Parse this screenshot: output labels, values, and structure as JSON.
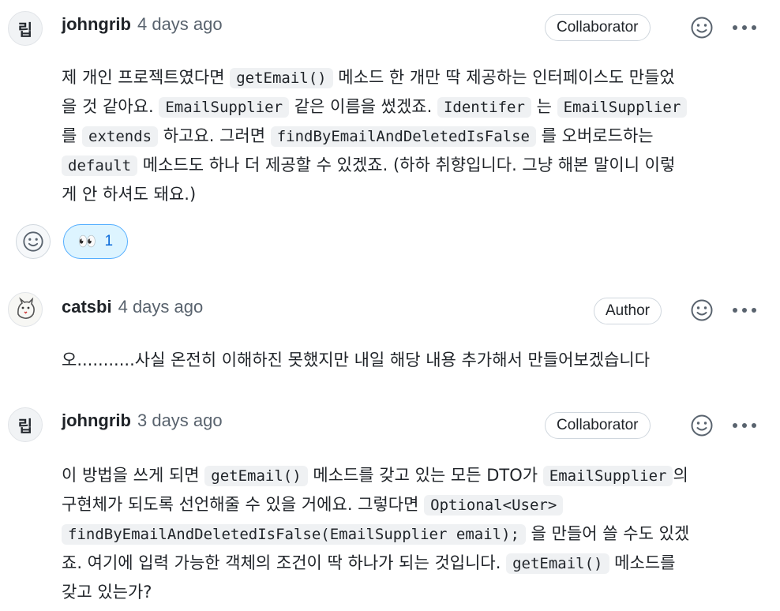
{
  "comments": [
    {
      "avatar_text": "립",
      "author": "johngrib",
      "time": "4 days ago",
      "badge": "Collaborator",
      "lines": [
        [
          {
            "t": "제 개인 프로젝트였다면 "
          },
          {
            "c": "getEmail()"
          },
          {
            "t": " 메소드 한 개만 딱 제공하는 인터페이스도 만들었"
          }
        ],
        [
          {
            "t": "을 것 같아요. "
          },
          {
            "c": "EmailSupplier"
          },
          {
            "t": " 같은 이름을 썼겠죠. "
          },
          {
            "c": "Identifer"
          },
          {
            "t": " 는 "
          },
          {
            "c": "EmailSupplier"
          }
        ],
        [
          {
            "t": "를 "
          },
          {
            "c": "extends"
          },
          {
            "t": " 하고요. 그러면 "
          },
          {
            "c": "findByEmailAndDeletedIsFalse"
          },
          {
            "t": " 를 오버로드하는"
          }
        ],
        [
          {
            "c": "default"
          },
          {
            "t": " 메소드도 하나 더 제공할 수 있겠죠. (하하 취향입니다. 그냥 해본 말이니 이렇"
          }
        ],
        [
          {
            "t": "게 안 하셔도 돼요.)"
          }
        ]
      ],
      "reaction": {
        "emoji": "👀",
        "count": "1"
      }
    },
    {
      "author": "catsbi",
      "time": "4 days ago",
      "badge": "Author",
      "text": "오...........사실 온전히 이해하진 못했지만 내일 해당 내용 추가해서 만들어보겠습니다"
    },
    {
      "avatar_text": "립",
      "author": "johngrib",
      "time": "3 days ago",
      "badge": "Collaborator",
      "lines": [
        [
          {
            "t": "이 방법을 쓰게 되면 "
          },
          {
            "c": "getEmail()"
          },
          {
            "t": " 메소드를 갖고 있는 모든 DTO가 "
          },
          {
            "c": "EmailSupplier"
          },
          {
            "t": "의"
          }
        ],
        [
          {
            "t": "구현체가 되도록 선언해줄 수 있을 거에요. 그렇다면 "
          },
          {
            "c": "Optional<User>"
          }
        ],
        [
          {
            "c": "findByEmailAndDeletedIsFalse(EmailSupplier email);"
          },
          {
            "t": " 을 만들어 쓸 수도 있겠"
          }
        ],
        [
          {
            "t": "죠. 여기에 입력 가능한 객체의 조건이 딱 하나가 되는 것입니다. "
          },
          {
            "c": "getEmail()"
          },
          {
            "t": " 메소드를"
          }
        ],
        [
          {
            "t": "갖고 있는가?"
          }
        ]
      ]
    }
  ],
  "icons": {
    "smiley": "smiley-icon",
    "more": "kebab-horizontal-icon"
  }
}
